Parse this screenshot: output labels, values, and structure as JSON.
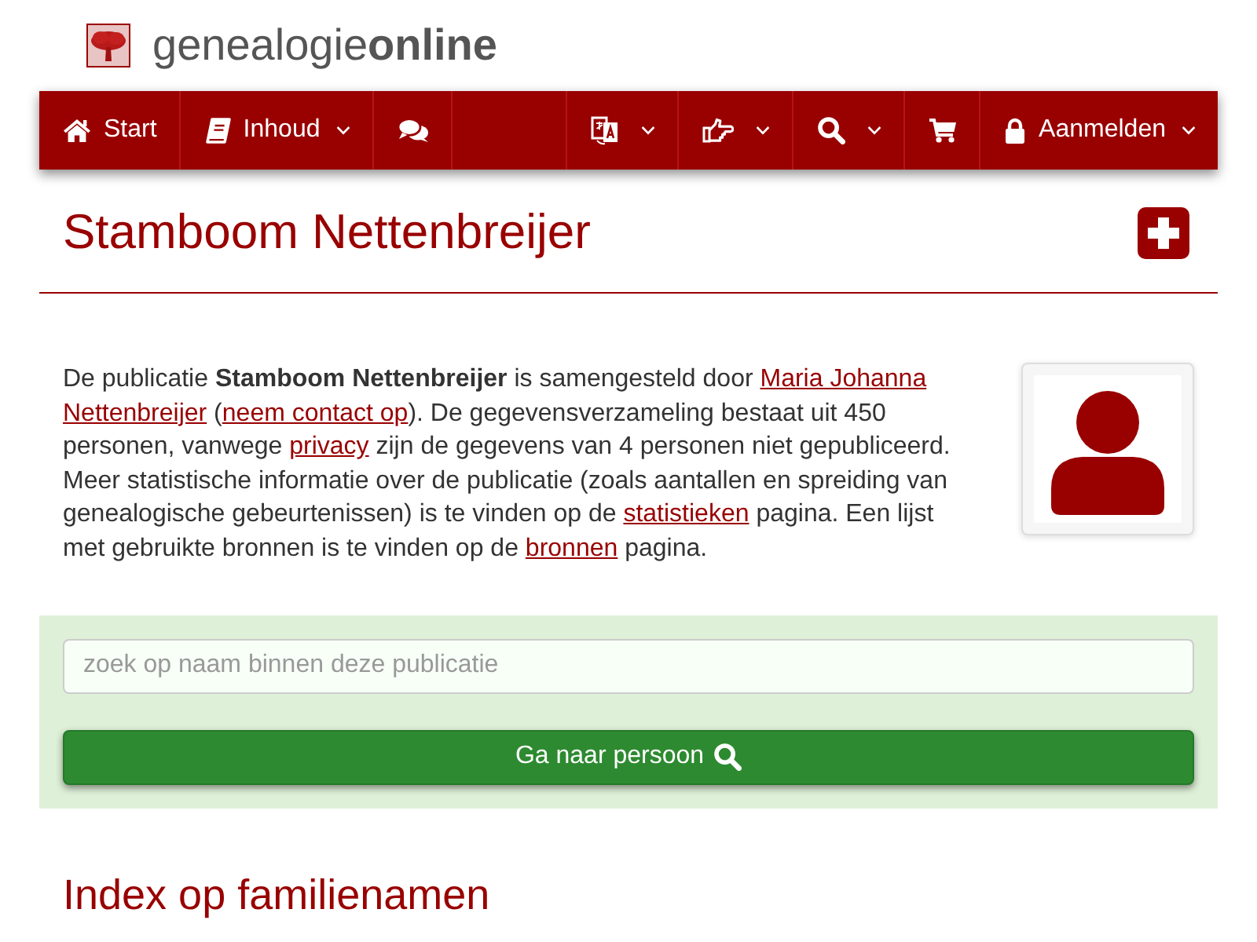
{
  "logo": {
    "text": "genealogie**online**"
  },
  "navbar": {
    "left": [
      {
        "label": "Start",
        "dropdown": false
      },
      {
        "label": "Inhoud",
        "dropdown": true
      },
      {
        "dropdown": false
      }
    ],
    "right": [
      {
        "dropdown": true
      },
      {
        "dropdown": true
      },
      {
        "dropdown": true
      },
      {
        "dropdown": false
      },
      {
        "label": "Aanmelden",
        "dropdown": true
      }
    ]
  },
  "title": "Stamboom Nettenbreijer",
  "intro": {
    "parts": [
      {
        "kind": "text",
        "text": "De publicatie **Stamboom Nettenbreijer** is samengesteld door "
      },
      {
        "kind": "link",
        "text": "Maria Johanna"
      },
      {
        "kind": "link",
        "text": "Nettenbreijer"
      },
      {
        "kind": "text",
        "text": " ("
      },
      {
        "kind": "link",
        "text": "neem contact op"
      },
      {
        "kind": "text",
        "text": "). De gegevensverzameling bestaat uit 450 personen, vanwege "
      },
      {
        "kind": "link",
        "text": "privacy"
      },
      {
        "kind": "text",
        "text": " zijn de gegevens van 4 personen niet gepubliceerd. Meer statistische informatie over de publicatie (zoals aantallen en spreiding van genealogische gebeurtenissen) is te vinden op de "
      },
      {
        "kind": "link",
        "text": "statistieken"
      },
      {
        "kind": "text",
        "text": " pagina. Een lijst met gebruikte bronnen is te vinden op de "
      },
      {
        "kind": "link",
        "text": "bronnen"
      },
      {
        "kind": "text",
        "text": " pagina."
      }
    ]
  },
  "search": {
    "placeholder": "zoek op naam binnen deze publicatie",
    "button": "Ga naar persoon"
  },
  "section_heading": "Index op familienamen"
}
